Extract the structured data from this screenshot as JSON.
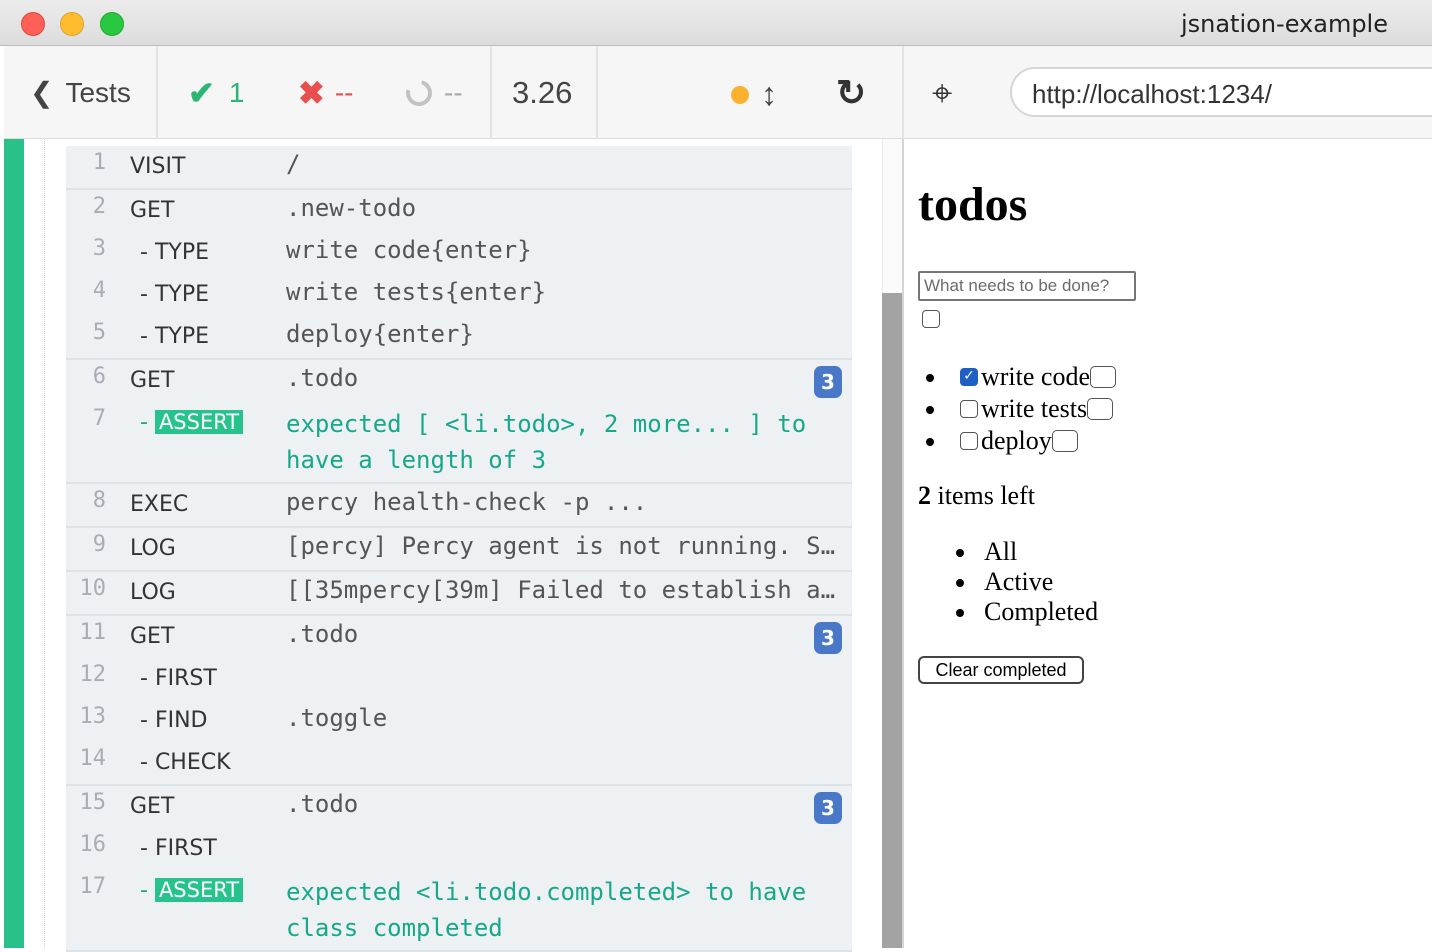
{
  "window": {
    "title": "jsnation-example"
  },
  "toolbar": {
    "back_label": "Tests",
    "passed": "1",
    "failed": "--",
    "pending": "--",
    "duration": "3.26",
    "url": "http://localhost:1234/"
  },
  "commands": [
    {
      "rows": [
        {
          "num": "1",
          "name": "VISIT",
          "child": false,
          "msg": "/"
        }
      ]
    },
    {
      "rows": [
        {
          "num": "2",
          "name": "GET",
          "child": false,
          "msg": ".new-todo"
        },
        {
          "num": "3",
          "name": "TYPE",
          "child": true,
          "msg": "write code{enter}"
        },
        {
          "num": "4",
          "name": "TYPE",
          "child": true,
          "msg": "write tests{enter}"
        },
        {
          "num": "5",
          "name": "TYPE",
          "child": true,
          "msg": "deploy{enter}"
        }
      ]
    },
    {
      "count": "3",
      "rows": [
        {
          "num": "6",
          "name": "GET",
          "child": false,
          "msg": ".todo"
        },
        {
          "num": "7",
          "name": "ASSERT",
          "child": true,
          "assert": true,
          "msg": "expected  [ <li.todo>, 2 more... ]  to have a length of  3"
        }
      ]
    },
    {
      "rows": [
        {
          "num": "8",
          "name": "EXEC",
          "child": false,
          "msg": "percy health-check -p ..."
        }
      ]
    },
    {
      "rows": [
        {
          "num": "9",
          "name": "LOG",
          "child": false,
          "msg": "[percy] Percy agent is not running. S…"
        }
      ]
    },
    {
      "rows": [
        {
          "num": "10",
          "name": "LOG",
          "child": false,
          "msg": "[[35mpercy[39m] Failed to establish a…"
        }
      ]
    },
    {
      "count": "3",
      "rows": [
        {
          "num": "11",
          "name": "GET",
          "child": false,
          "msg": ".todo"
        },
        {
          "num": "12",
          "name": "FIRST",
          "child": true,
          "msg": ""
        },
        {
          "num": "13",
          "name": "FIND",
          "child": true,
          "msg": ".toggle"
        },
        {
          "num": "14",
          "name": "CHECK",
          "child": true,
          "msg": ""
        }
      ]
    },
    {
      "count": "3",
      "rows": [
        {
          "num": "15",
          "name": "GET",
          "child": false,
          "msg": ".todo"
        },
        {
          "num": "16",
          "name": "FIRST",
          "child": true,
          "msg": ""
        },
        {
          "num": "17",
          "name": "ASSERT",
          "child": true,
          "assert": true,
          "msg": "expected  <li.todo.completed>  to have class  completed"
        }
      ]
    }
  ],
  "app": {
    "heading": "todos",
    "new_todo_placeholder": "What needs to be done?",
    "todos": [
      {
        "label": "write code",
        "checked": true
      },
      {
        "label": "write tests",
        "checked": false
      },
      {
        "label": "deploy",
        "checked": false
      }
    ],
    "items_left_count": "2",
    "items_left_text": " items left",
    "filters": [
      "All",
      "Active",
      "Completed"
    ],
    "clear_completed": "Clear completed"
  }
}
